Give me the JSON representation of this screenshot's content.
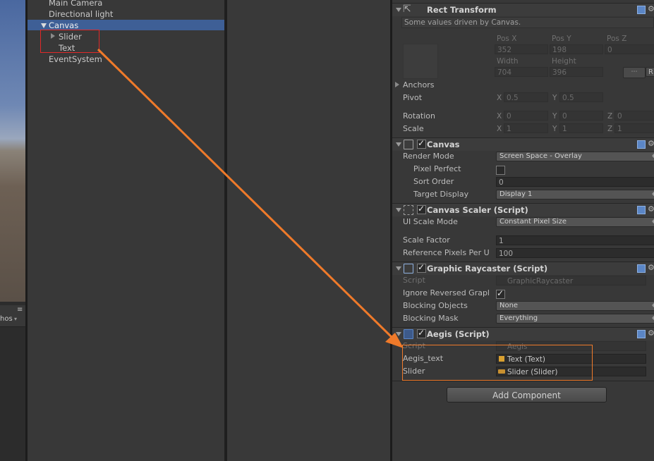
{
  "scene": {
    "view_label": "hos"
  },
  "hierarchy": {
    "items": [
      {
        "label": "Main Camera"
      },
      {
        "label": "Directional light"
      },
      {
        "label": "Canvas"
      },
      {
        "label": "Slider"
      },
      {
        "label": "Text"
      },
      {
        "label": "EventSystem"
      }
    ]
  },
  "rect_transform": {
    "title": "Rect Transform",
    "note": "Some values driven by Canvas.",
    "pos_x_label": "Pos X",
    "pos_y_label": "Pos Y",
    "pos_z_label": "Pos Z",
    "pos_x": "352",
    "pos_y": "198",
    "pos_z": "0",
    "width_label": "Width",
    "height_label": "Height",
    "width": "704",
    "height": "396",
    "r_button": "R",
    "anchors_label": "Anchors",
    "pivot_label": "Pivot",
    "pivot_x": "0.5",
    "pivot_y": "0.5",
    "rotation_label": "Rotation",
    "rot_x": "0",
    "rot_y": "0",
    "rot_z": "0",
    "scale_label": "Scale",
    "scale_x": "1",
    "scale_y": "1",
    "scale_z": "1",
    "x": "X",
    "y": "Y",
    "z": "Z"
  },
  "canvas": {
    "title": "Canvas",
    "render_mode_label": "Render Mode",
    "render_mode": "Screen Space - Overlay",
    "pixel_perfect_label": "Pixel Perfect",
    "sort_order_label": "Sort Order",
    "sort_order": "0",
    "target_display_label": "Target Display",
    "target_display": "Display 1"
  },
  "canvas_scaler": {
    "title": "Canvas Scaler (Script)",
    "ui_scale_mode_label": "UI Scale Mode",
    "ui_scale_mode": "Constant Pixel Size",
    "scale_factor_label": "Scale Factor",
    "scale_factor": "1",
    "ref_pixels_label": "Reference Pixels Per U",
    "ref_pixels": "100"
  },
  "graphic_raycaster": {
    "title": "Graphic Raycaster (Script)",
    "script_label": "Script",
    "script_value": "GraphicRaycaster",
    "ignore_reversed_label": "Ignore Reversed Grapl",
    "blocking_objects_label": "Blocking Objects",
    "blocking_objects": "None",
    "blocking_mask_label": "Blocking Mask",
    "blocking_mask": "Everything"
  },
  "aegis": {
    "title": "Aegis (Script)",
    "script_label": "Script",
    "script_value": "Aegis",
    "aegis_text_label": "Aegis_text",
    "aegis_text_value": "Text (Text)",
    "slider_label": "Slider",
    "slider_value": "Slider (Slider)"
  },
  "add_component_label": "Add Component",
  "colors": {
    "selection": "#3e5f96",
    "annotation_red": "#e02828",
    "annotation_orange": "#ef7a2a"
  }
}
